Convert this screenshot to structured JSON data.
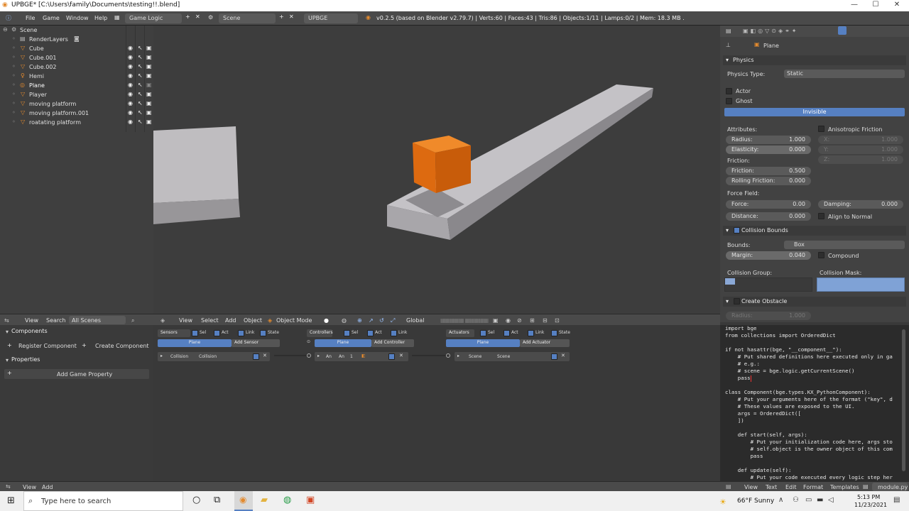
{
  "window": {
    "title": "UPBGE* [C:\\Users\\family\\Documents\\testing!!.blend]",
    "min": "—",
    "max": "☐",
    "close": "✕"
  },
  "topbar": {
    "menus": [
      "File",
      "Game",
      "Window",
      "Help"
    ],
    "screen": "Game Logic",
    "scene": "Scene",
    "engine": "UPBGE",
    "info": "v0.2.5 (based on Blender v2.79.7) | Verts:60 | Faces:43 | Tris:86 | Objects:1/11 | Lamps:0/2 | Mem: 18.3 MB ."
  },
  "outliner": {
    "items": [
      {
        "label": "Scene",
        "icon": "scene-icon"
      },
      {
        "label": "RenderLayers",
        "icon": "renderlayers-icon"
      },
      {
        "label": "Cube",
        "icon": "mesh-icon"
      },
      {
        "label": "Cube.001",
        "icon": "mesh-icon"
      },
      {
        "label": "Cube.002",
        "icon": "mesh-icon"
      },
      {
        "label": "Hemi",
        "icon": "lamp-icon"
      },
      {
        "label": "Plane",
        "icon": "mesh-icon"
      },
      {
        "label": "Player",
        "icon": "mesh-icon"
      },
      {
        "label": "moving platform",
        "icon": "mesh-icon"
      },
      {
        "label": "moving platform.001",
        "icon": "mesh-icon"
      },
      {
        "label": "roatating platform",
        "icon": "mesh-icon"
      }
    ]
  },
  "viewport_header": {
    "items": [
      "View",
      "Select",
      "Add",
      "Object"
    ],
    "mode": "Object Mode",
    "orientation": "Global"
  },
  "left_header": {
    "items": [
      "View",
      "Search"
    ],
    "filter": "All Scenes"
  },
  "left_panel": {
    "components": "Components",
    "register": "Register Component",
    "create": "Create Component",
    "properties": "Properties",
    "add_prop": "Add Game Property"
  },
  "logic": {
    "sensors": {
      "title": "Sensors",
      "flags": [
        "Sel",
        "Act",
        "Link",
        "State"
      ],
      "obj": "Plane",
      "add": "Add Sensor",
      "brick": "Collision",
      "brick_name": "Collision"
    },
    "controllers": {
      "title": "Controllers",
      "flags": [
        "Sel",
        "Act",
        "Link"
      ],
      "obj": "Plane",
      "add": "Add Controller",
      "brick": "An",
      "brick_name": "An",
      "num": "1"
    },
    "actuators": {
      "title": "Actuators",
      "flags": [
        "Sel",
        "Act",
        "Link",
        "State"
      ],
      "obj": "Plane",
      "add": "Add Actuator",
      "brick": "Scene",
      "brick_name": "Scene"
    }
  },
  "props": {
    "object": "Plane",
    "physics": "Physics",
    "physics_type_label": "Physics Type:",
    "physics_type": "Static",
    "actor": "Actor",
    "ghost": "Ghost",
    "invisible": "Invisible",
    "attributes": "Attributes:",
    "radius": {
      "k": "Radius:",
      "v": "1.000"
    },
    "elasticity": {
      "k": "Elasticity:",
      "v": "0.000"
    },
    "aniso": "Anisotropic Friction",
    "ax": {
      "x": "X:",
      "xv": "1.000",
      "y": "Y:",
      "yv": "1.000",
      "z": "Z:",
      "zv": "1.000"
    },
    "friction": "Friction:",
    "friction_v": {
      "k": "Friction:",
      "v": "0.500"
    },
    "rolling": {
      "k": "Rolling Friction:",
      "v": "0.000"
    },
    "force_field": "Force Field:",
    "force": {
      "k": "Force:",
      "v": "0.00"
    },
    "damping": {
      "k": "Damping:",
      "v": "0.000"
    },
    "distance": {
      "k": "Distance:",
      "v": "0.000"
    },
    "align": "Align to Normal",
    "collision_bounds": "Collision Bounds",
    "bounds_label": "Bounds:",
    "bounds": "Box",
    "margin": {
      "k": "Margin:",
      "v": "0.040"
    },
    "compound": "Compound",
    "group": "Collision Group:",
    "mask": "Collision Mask:",
    "create_obstacle": "Create Obstacle",
    "obs_radius": {
      "k": "Radius:",
      "v": "1.000"
    }
  },
  "code": [
    "import bge",
    "from collections import OrderedDict",
    "",
    "if not hasattr(bge, \"__component__\"):",
    "    # Put shared definitions here executed only in ga",
    "    # e.g.:",
    "    # scene = bge.logic.getCurrentScene()",
    "    pass",
    "",
    "class Component(bge.types.KX_PythonComponent):",
    "    # Put your arguments here of the format (\"key\", d",
    "    # These values are exposed to the UI.",
    "    args = OrderedDict([",
    "    ])",
    "",
    "    def start(self, args):",
    "        # Put your initialization code here, args sto",
    "        # self.object is the owner object of this com",
    "        pass",
    "",
    "    def update(self):",
    "        # Put your code executed every logic step her"
  ],
  "bottom": {
    "left": [
      "View",
      "Add"
    ],
    "text_menus": [
      "View",
      "Text",
      "Edit",
      "Format",
      "Templates"
    ],
    "file": "module.py"
  },
  "taskbar": {
    "search": "Type here to search",
    "weather": "66°F  Sunny",
    "time": "5:13 PM",
    "date": "11/23/2021"
  },
  "colors": {
    "accent": "#5680c2",
    "orange": "#e06b0d"
  }
}
